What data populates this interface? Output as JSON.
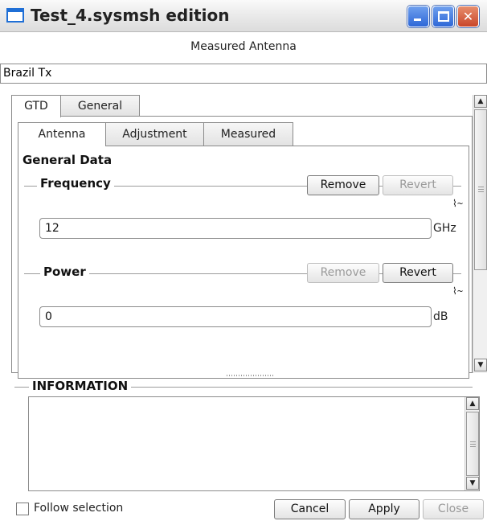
{
  "window": {
    "title": "Test_4.sysmsh edition",
    "buttons": [
      "minimize",
      "maximize",
      "close"
    ]
  },
  "header": {
    "label": "Measured Antenna",
    "name_value": "Brazil Tx"
  },
  "outer_tabs": [
    {
      "label": "GTD",
      "active": true
    },
    {
      "label": "General",
      "active": false
    }
  ],
  "inner_tabs": [
    {
      "label": "Antenna",
      "active": true
    },
    {
      "label": "Adjustment",
      "active": false
    },
    {
      "label": "Measured",
      "active": false
    }
  ],
  "general_data": {
    "title": "General Data",
    "frequency": {
      "label": "Frequency",
      "remove_label": "Remove",
      "revert_label": "Revert",
      "value": "12",
      "unit": "GHz",
      "remove_enabled": true,
      "revert_enabled": false
    },
    "power": {
      "label": "Power",
      "remove_label": "Remove",
      "revert_label": "Revert",
      "value": "0",
      "unit": "dB",
      "remove_enabled": false,
      "revert_enabled": true
    }
  },
  "information": {
    "label": "INFORMATION",
    "text": ""
  },
  "footer": {
    "follow_selection_label": "Follow selection",
    "follow_selection_checked": false,
    "cancel_label": "Cancel",
    "apply_label": "Apply",
    "close_label": "Close"
  },
  "colors": {
    "title_icon_blue": "#1f6fd6",
    "window_button_blue": "#2e67d7",
    "close_button_red": "#c8462a",
    "disabled_text": "#9a9a9a"
  },
  "icons": {
    "graph": "chart-curve-icon",
    "scroll_up": "arrow-up-icon",
    "scroll_down": "arrow-down-icon"
  }
}
